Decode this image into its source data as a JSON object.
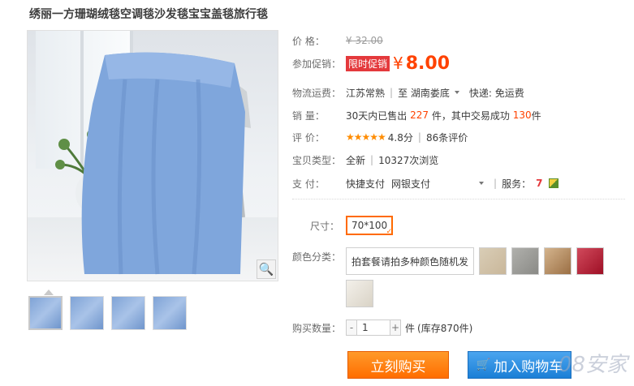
{
  "product": {
    "title": "绣丽一方珊瑚绒毯空调毯沙发毯宝宝盖毯旅行毯"
  },
  "price": {
    "label": "价    格：",
    "original": "¥ 32.00"
  },
  "promo": {
    "label": "参加促销：",
    "tag": "限时促销",
    "currency": "¥",
    "value": "8.00"
  },
  "shipping": {
    "label": "物流运费：",
    "from": "江苏常熟",
    "to_prefix": "至",
    "to": "湖南娄底",
    "fee": "快递: 免运费"
  },
  "sales": {
    "label": "销    量：",
    "prefix": "30天内已售出",
    "count": "227",
    "mid": "件，其中交易成功",
    "success": "130",
    "unit": "件"
  },
  "rating": {
    "label": "评    价：",
    "stars": "★★★★★",
    "score": "4.8分",
    "reviews": "86条评价"
  },
  "type": {
    "label": "宝贝类型：",
    "value": "全新",
    "views": "10327次浏览"
  },
  "payment": {
    "label": "支    付：",
    "method1": "快捷支付",
    "method2": "网银支付",
    "service_label": "服务：",
    "service_icon": "7"
  },
  "size": {
    "label": "尺寸：",
    "selected": "70*100"
  },
  "color": {
    "label": "颜色分类：",
    "option_text": "拍套餐请拍多种颜色随机发",
    "swatches": [
      "#c9b79a",
      "#8a8a86",
      "#b88f63",
      "#b3122a",
      "#e8e4db"
    ]
  },
  "quantity": {
    "label": "购买数量：",
    "minus": "-",
    "value": "1",
    "plus": "+",
    "unit": "件",
    "stock": "(库存870件)"
  },
  "buttons": {
    "buy": "立刻购买",
    "cart": "加入购物车"
  },
  "watermark": "08安家",
  "colors": {
    "accent": "#ff4200",
    "buy": "#ff6d00",
    "cart": "#1b7fd6"
  }
}
